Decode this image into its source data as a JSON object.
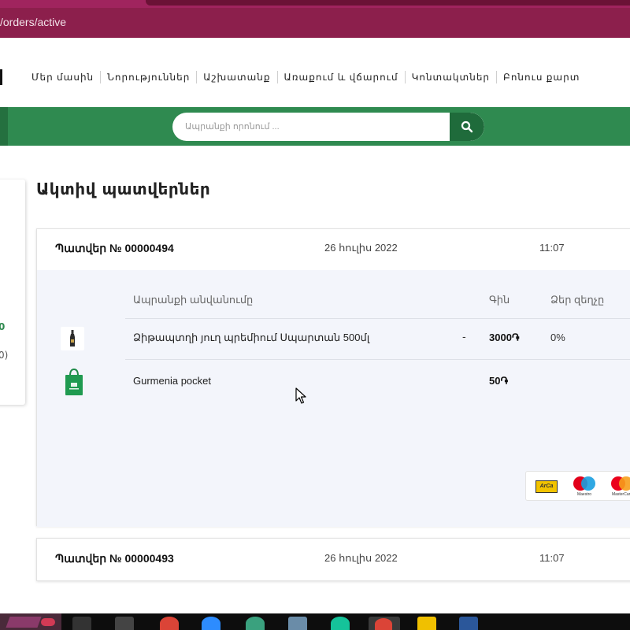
{
  "browser": {
    "url": "/orders/active"
  },
  "nav": {
    "items": [
      "Մեր մասին",
      "Նորություններ",
      "Աշխատանք",
      "Առաքում և վճարում",
      "Կոնտակտներ",
      "Բոնուս քարտ"
    ]
  },
  "search": {
    "placeholder": "Ապրանքի որոնում ..."
  },
  "sidebar": {
    "dot": "0",
    "fragment": "0)"
  },
  "page": {
    "title": "Ակտիվ պատվերներ"
  },
  "orders": [
    {
      "number": "Պատվեր № 00000494",
      "date": "26 հուլիս 2022",
      "time": "11:07",
      "headers": {
        "name": "Ապրանքի անվանումը",
        "price": "Գին",
        "discount": "Ձեր զեղչը"
      },
      "items": [
        {
          "name": "Ձիթապտղի յուղ պրեմիում Սպարտան 500մլ",
          "dash": "-",
          "price": "3000֏",
          "discount": "0%",
          "icon": "bottle-icon"
        },
        {
          "name": "Gurmenia pocket",
          "dash": "",
          "price": "50֏",
          "discount": "",
          "icon": "shopping-bag-icon"
        }
      ],
      "payments": [
        {
          "name": "ArCa",
          "icon": "arca-card-icon"
        },
        {
          "name": "Maestro",
          "icon": "maestro-card-icon"
        },
        {
          "name": "MasterCard",
          "icon": "mastercard-icon"
        }
      ]
    },
    {
      "number": "Պատվեր № 00000493",
      "date": "26 հուլիս 2022",
      "time": "11:07"
    }
  ],
  "colors": {
    "browser": "#8c1f4c",
    "green": "#2f8a50",
    "darkgreen": "#1f6b3b"
  }
}
